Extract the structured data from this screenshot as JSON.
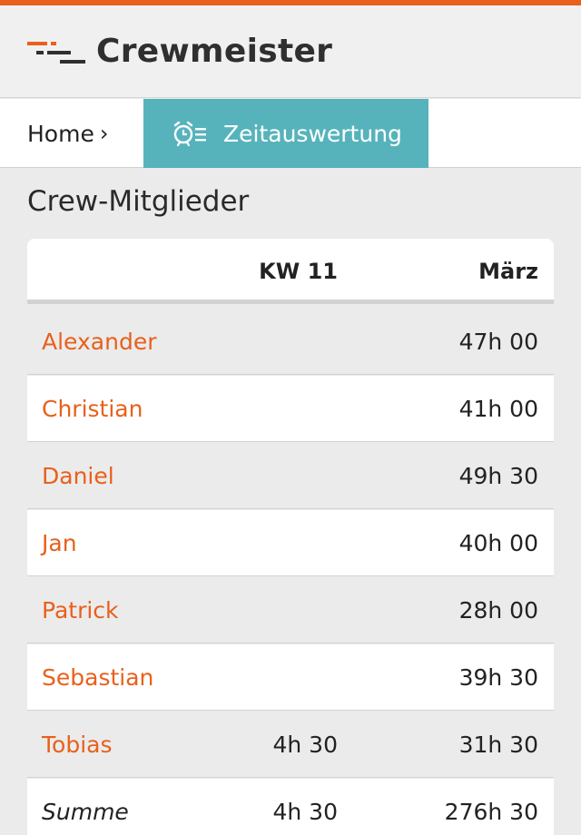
{
  "app": {
    "name": "Crewmeister",
    "accent": "#e8601c",
    "teal": "#56b3bb"
  },
  "breadcrumb": {
    "home": "Home",
    "chevron": "›",
    "current": "Zeitauswertung",
    "current_icon": "alarm-clock-list-icon"
  },
  "section": {
    "title": "Crew-Mitglieder"
  },
  "table": {
    "headers": {
      "name": "",
      "week": "KW 11",
      "month": "März"
    },
    "rows": [
      {
        "name": "Alexander",
        "week": "",
        "month": "47h 00"
      },
      {
        "name": "Christian",
        "week": "",
        "month": "41h 00"
      },
      {
        "name": "Daniel",
        "week": "",
        "month": "49h 30"
      },
      {
        "name": "Jan",
        "week": "",
        "month": "40h 00"
      },
      {
        "name": "Patrick",
        "week": "",
        "month": "28h 00"
      },
      {
        "name": "Sebastian",
        "week": "",
        "month": "39h 30"
      },
      {
        "name": "Tobias",
        "week": "4h 30",
        "month": "31h 30"
      }
    ],
    "total": {
      "name": "Summe",
      "week": "4h 30",
      "month": "276h 30"
    }
  }
}
